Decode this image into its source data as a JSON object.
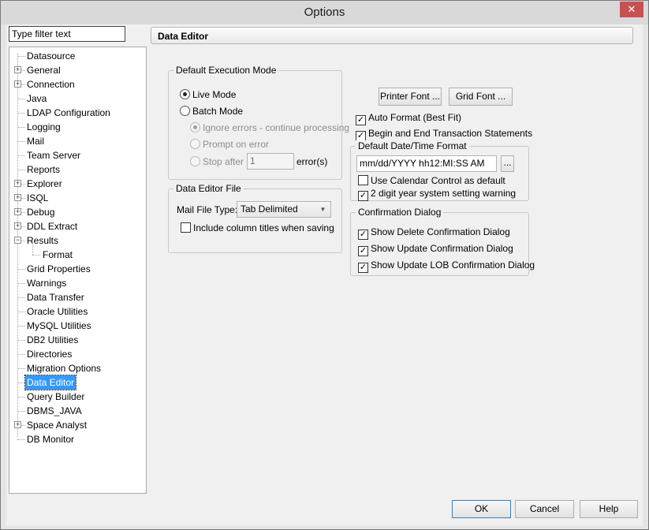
{
  "window": {
    "title": "Options",
    "close_glyph": "✕"
  },
  "filter": {
    "value": "Type filter text"
  },
  "tree": {
    "items": [
      {
        "label": "Datasource",
        "expandable": false,
        "level": 0
      },
      {
        "label": "General",
        "expandable": true,
        "level": 0
      },
      {
        "label": "Connection",
        "expandable": true,
        "level": 0
      },
      {
        "label": "Java",
        "expandable": false,
        "level": 0
      },
      {
        "label": "LDAP Configuration",
        "expandable": false,
        "level": 0
      },
      {
        "label": "Logging",
        "expandable": false,
        "level": 0
      },
      {
        "label": "Mail",
        "expandable": false,
        "level": 0
      },
      {
        "label": "Team Server",
        "expandable": false,
        "level": 0
      },
      {
        "label": "Reports",
        "expandable": false,
        "level": 0
      },
      {
        "label": "Explorer",
        "expandable": true,
        "level": 0
      },
      {
        "label": "ISQL",
        "expandable": true,
        "level": 0
      },
      {
        "label": "Debug",
        "expandable": true,
        "level": 0
      },
      {
        "label": "DDL Extract",
        "expandable": true,
        "level": 0
      },
      {
        "label": "Results",
        "expandable": true,
        "expanded": true,
        "level": 0
      },
      {
        "label": "Format",
        "expandable": false,
        "level": 1
      },
      {
        "label": "Grid Properties",
        "expandable": false,
        "level": 0
      },
      {
        "label": "Warnings",
        "expandable": false,
        "level": 0
      },
      {
        "label": "Data Transfer",
        "expandable": false,
        "level": 0
      },
      {
        "label": "Oracle Utilities",
        "expandable": false,
        "level": 0
      },
      {
        "label": "MySQL Utilities",
        "expandable": false,
        "level": 0
      },
      {
        "label": "DB2 Utilities",
        "expandable": false,
        "level": 0
      },
      {
        "label": "Directories",
        "expandable": false,
        "level": 0
      },
      {
        "label": "Migration Options",
        "expandable": false,
        "level": 0
      },
      {
        "label": "Data Editor",
        "expandable": false,
        "level": 0,
        "selected": true
      },
      {
        "label": "Query Builder",
        "expandable": false,
        "level": 0
      },
      {
        "label": "DBMS_JAVA",
        "expandable": false,
        "level": 0
      },
      {
        "label": "Space Analyst",
        "expandable": true,
        "level": 0
      },
      {
        "label": "DB Monitor",
        "expandable": false,
        "level": 0
      }
    ]
  },
  "panel": {
    "header": "Data Editor",
    "exec_mode": {
      "title": "Default Execution Mode",
      "live_mode": "Live Mode",
      "batch_mode": "Batch Mode",
      "ignore_errors": "Ignore errors - continue processing",
      "prompt_on_error": "Prompt on error",
      "stop_after": "Stop after",
      "stop_after_value": "1",
      "errors_suffix": "error(s)"
    },
    "file": {
      "title": "Data Editor File",
      "mail_file_type_label": "Mail File Type:",
      "mail_file_type_value": "Tab Delimited",
      "include_titles": "Include column titles when saving"
    },
    "buttons": {
      "printer_font": "Printer Font ...",
      "grid_font": "Grid Font ..."
    },
    "auto_format": "Auto Format (Best Fit)",
    "begin_end_tx": "Begin and End Transaction Statements",
    "datetime": {
      "title": "Default Date/Time Format",
      "value": "mm/dd/YYYY hh12:MI:SS AM",
      "browse": "...",
      "calendar": "Use Calendar Control as default",
      "two_digit": "2 digit year system setting warning"
    },
    "confirm": {
      "title": "Confirmation Dialog",
      "delete": "Show Delete Confirmation Dialog",
      "update": "Show Update Confirmation Dialog",
      "update_lob": "Show Update LOB Confirmation Dialog"
    }
  },
  "footer": {
    "ok": "OK",
    "cancel": "Cancel",
    "help": "Help"
  },
  "icons": {
    "check_glyph": "✓",
    "dropdown_glyph": "▼",
    "expand_glyph": "+",
    "collapse_glyph": "−"
  },
  "colors": {
    "selection": "#3399ff",
    "close": "#c75050"
  }
}
